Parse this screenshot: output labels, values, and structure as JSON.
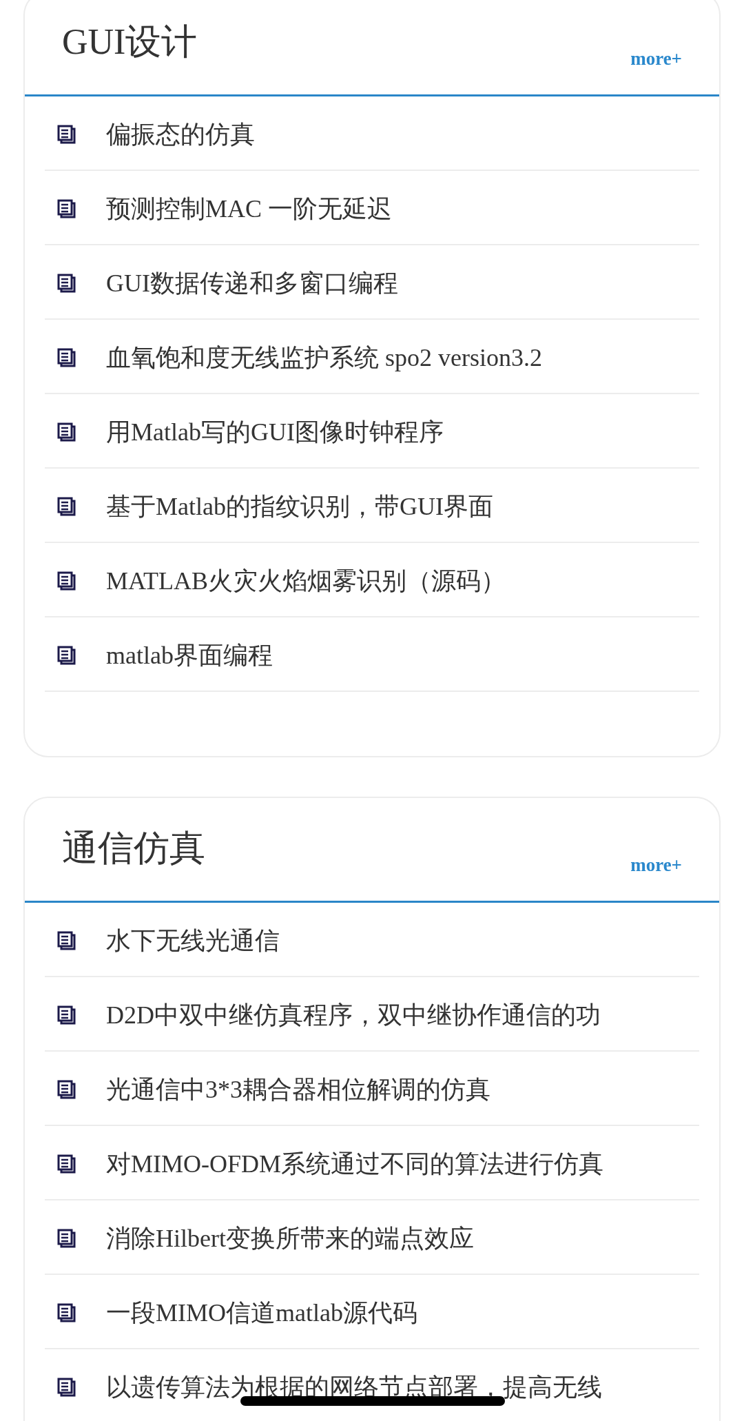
{
  "sections": [
    {
      "title": "GUI设计",
      "more": "more+",
      "items": [
        "偏振态的仿真",
        "预测控制MAC 一阶无延迟",
        "GUI数据传递和多窗口编程",
        "血氧饱和度无线监护系统 spo2 version3.2",
        "用Matlab写的GUI图像时钟程序",
        "基于Matlab的指纹识别，带GUI界面",
        "MATLAB火灾火焰烟雾识别（源码）",
        "matlab界面编程"
      ]
    },
    {
      "title": "通信仿真",
      "more": "more+",
      "items": [
        "水下无线光通信",
        "D2D中双中继仿真程序，双中继协作通信的功",
        "光通信中3*3耦合器相位解调的仿真",
        "对MIMO-OFDM系统通过不同的算法进行仿真",
        "消除Hilbert变换所带来的端点效应",
        "一段MIMO信道matlab源代码",
        "以遗传算法为根据的网络节点部署，提高无线"
      ]
    }
  ]
}
